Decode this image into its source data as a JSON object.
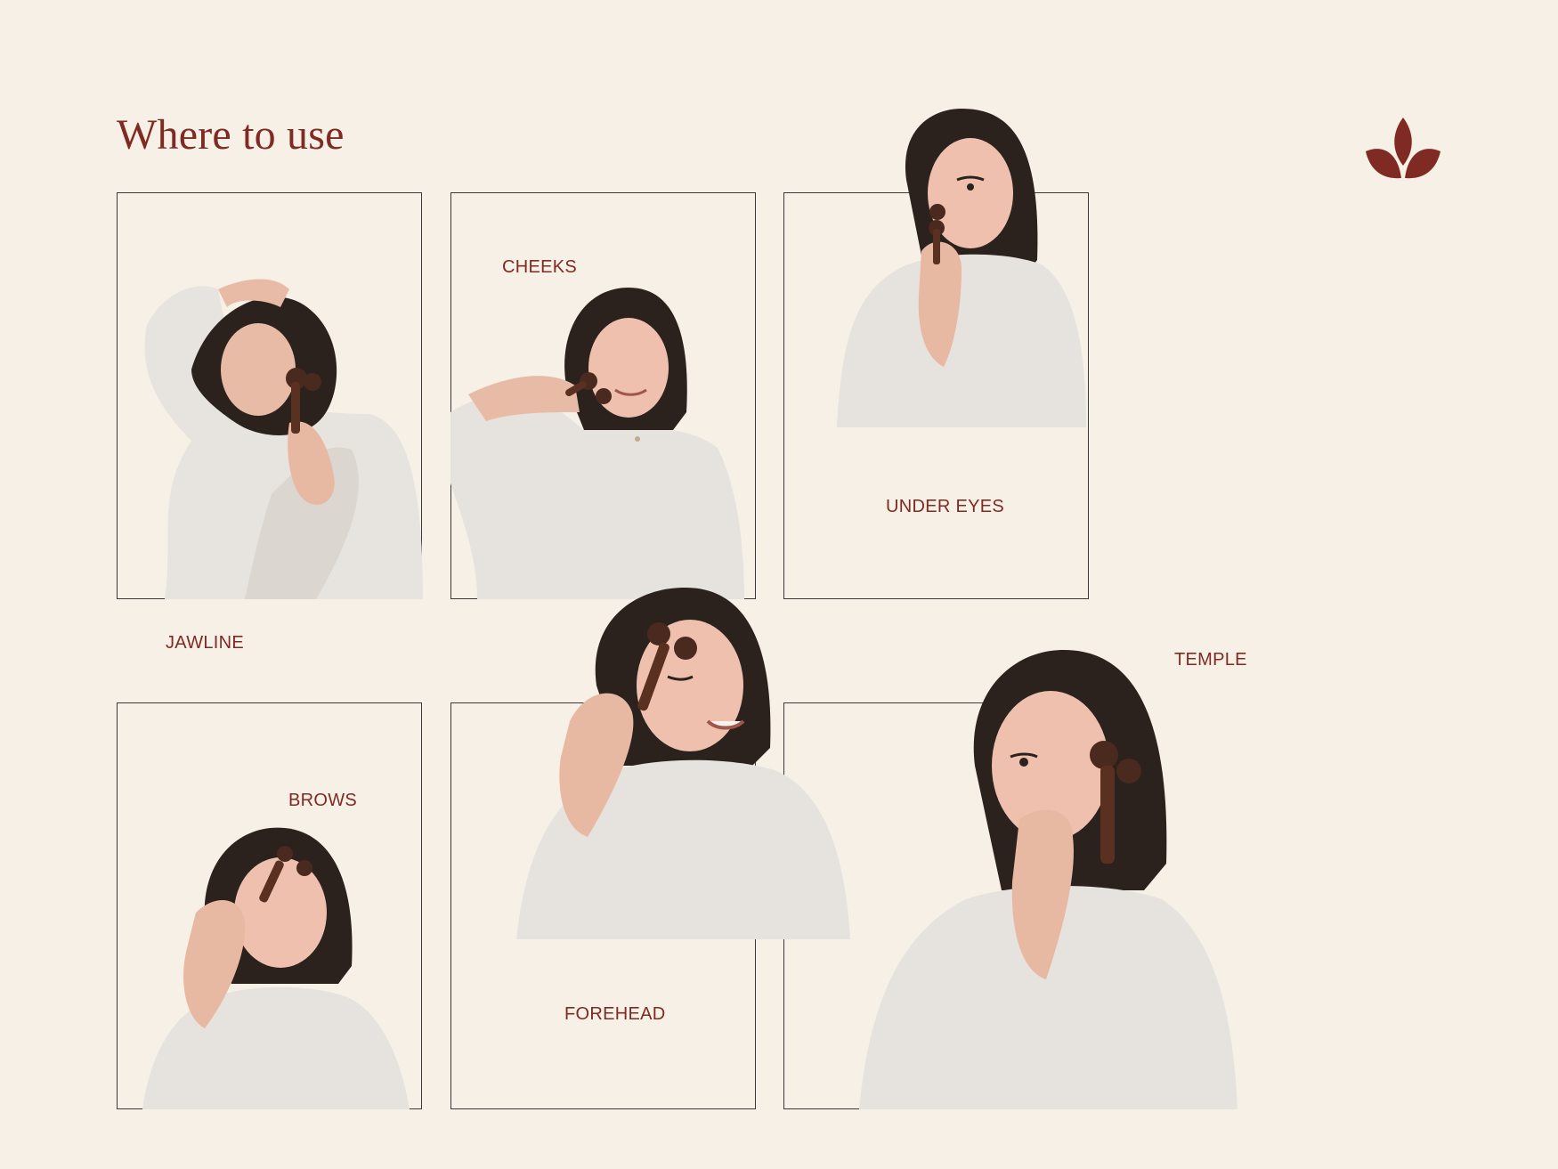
{
  "page": {
    "title": "Where to use",
    "logo_icon": "leaf-lotus-icon",
    "brand_color": "#7f2a22",
    "background": "#f7f0e6"
  },
  "areas": [
    {
      "id": "jawline",
      "label": "JAWLINE"
    },
    {
      "id": "cheeks",
      "label": "CHEEKS"
    },
    {
      "id": "under-eyes",
      "label": "UNDER EYES"
    },
    {
      "id": "brows",
      "label": "BROWS"
    },
    {
      "id": "forehead",
      "label": "FOREHEAD"
    },
    {
      "id": "temple",
      "label": "TEMPLE"
    }
  ]
}
